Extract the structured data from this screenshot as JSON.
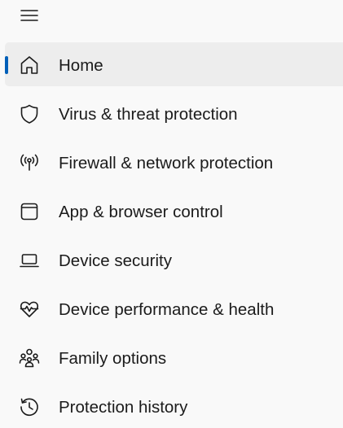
{
  "menu_icon": "hamburger-menu-icon",
  "accent_color": "#005fb8",
  "nav": {
    "items": [
      {
        "label": "Home",
        "icon": "home-icon",
        "selected": true
      },
      {
        "label": "Virus & threat protection",
        "icon": "shield-icon",
        "selected": false
      },
      {
        "label": "Firewall & network protection",
        "icon": "antenna-icon",
        "selected": false
      },
      {
        "label": "App & browser control",
        "icon": "app-window-icon",
        "selected": false
      },
      {
        "label": "Device security",
        "icon": "laptop-icon",
        "selected": false
      },
      {
        "label": "Device performance & health",
        "icon": "heart-pulse-icon",
        "selected": false
      },
      {
        "label": "Family options",
        "icon": "family-icon",
        "selected": false
      },
      {
        "label": "Protection history",
        "icon": "history-icon",
        "selected": false
      }
    ]
  }
}
